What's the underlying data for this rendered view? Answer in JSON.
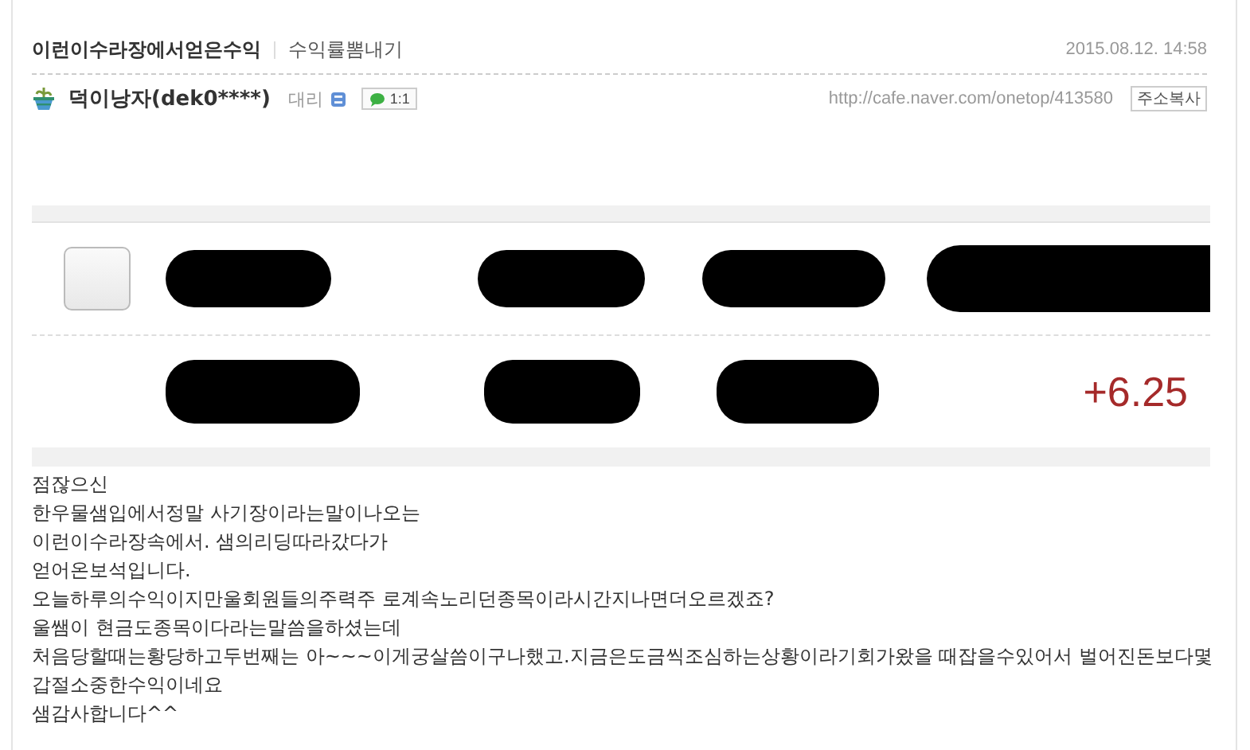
{
  "post": {
    "title": "이런이수라장에서얻은수익",
    "category": "수익률뽐내기",
    "date": "2015.08.12. 14:58"
  },
  "author": {
    "name": "덕이낭자(dek0****)",
    "rank": "대리",
    "chat": "1:1",
    "url": "http://cafe.naver.com/onetop/413580",
    "copy_button": "주소복사"
  },
  "embedded": {
    "checked": false,
    "change": "+6.25"
  },
  "body": [
    "점잖으신",
    "한우물샘입에서정말 사기장이라는말이나오는",
    "이런이수라장속에서. 샘의리딩따라갔다가",
    "얻어온보석입니다.",
    "오늘하루의수익이지만울회원들의주력주 로계속노리던종목이라시간지나면더오르겠죠?",
    "울쌤이 현금도종목이다라는말씀을하셨는데",
    "처음당할때는황당하고두번째는 아~~~이게궁살씀이구나했고.지금은도금씩조심하는상황이라기회가왔을 때잡을수있어서 벌어진돈보다몇",
    "갑절소중한수익이네요",
    "샘감사합니다^^"
  ]
}
